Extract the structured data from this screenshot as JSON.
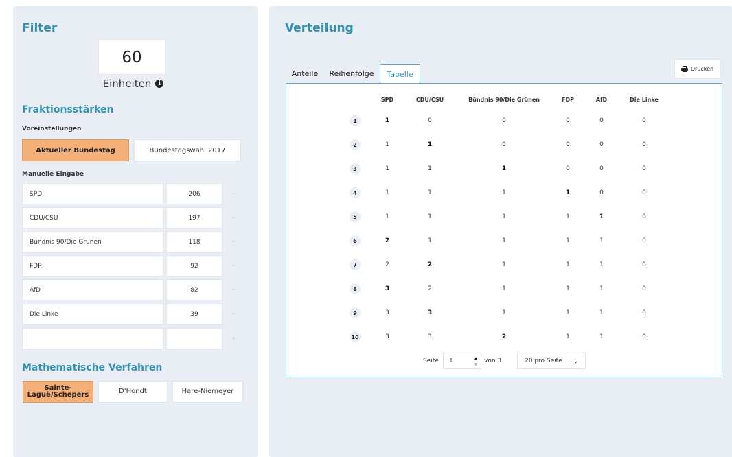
{
  "filter": {
    "title": "Filter",
    "units_value": "60",
    "units_label": "Einheiten",
    "info_icon": "info-icon",
    "fraktion_title": "Fraktionsstärken",
    "presets_label": "Voreinstellungen",
    "presets": [
      {
        "label": "Aktueller Bundestag",
        "active": true
      },
      {
        "label": "Bundestagswahl 2017",
        "active": false
      }
    ],
    "manual_label": "Manuelle Eingabe",
    "parties": [
      {
        "name": "SPD",
        "value": "206",
        "remove": "-"
      },
      {
        "name": "CDU/CSU",
        "value": "197",
        "remove": "-"
      },
      {
        "name": "Bündnis 90/Die Grünen",
        "value": "118",
        "remove": "-"
      },
      {
        "name": "FDP",
        "value": "92",
        "remove": "-"
      },
      {
        "name": "AfD",
        "value": "82",
        "remove": "-"
      },
      {
        "name": "Die Linke",
        "value": "39",
        "remove": "-"
      }
    ],
    "new_row": {
      "name": "",
      "value": "",
      "add": "+"
    },
    "method_title": "Mathematische Verfahren",
    "methods": [
      {
        "label": "Sainte-Laguë/Schepers",
        "active": true
      },
      {
        "label": "D'Hondt",
        "active": false
      },
      {
        "label": "Hare-Niemeyer",
        "active": false
      }
    ]
  },
  "distribution": {
    "title": "Verteilung",
    "tabs": [
      {
        "label": "Anteile",
        "active": false
      },
      {
        "label": "Reihenfolge",
        "active": false
      },
      {
        "label": "Tabelle",
        "active": true
      }
    ],
    "print_label": "Drucken",
    "print_icon": "printer-icon",
    "columns": [
      "SPD",
      "CDU/CSU",
      "Bündnis 90/Die Grünen",
      "FDP",
      "AfD",
      "Die Linke"
    ],
    "rows": [
      {
        "n": "1",
        "cells": [
          "1",
          "0",
          "0",
          "0",
          "0",
          "0"
        ],
        "bold": 0
      },
      {
        "n": "2",
        "cells": [
          "1",
          "1",
          "0",
          "0",
          "0",
          "0"
        ],
        "bold": 1
      },
      {
        "n": "3",
        "cells": [
          "1",
          "1",
          "1",
          "0",
          "0",
          "0"
        ],
        "bold": 2
      },
      {
        "n": "4",
        "cells": [
          "1",
          "1",
          "1",
          "1",
          "0",
          "0"
        ],
        "bold": 3
      },
      {
        "n": "5",
        "cells": [
          "1",
          "1",
          "1",
          "1",
          "1",
          "0"
        ],
        "bold": 4
      },
      {
        "n": "6",
        "cells": [
          "2",
          "1",
          "1",
          "1",
          "1",
          "0"
        ],
        "bold": 0
      },
      {
        "n": "7",
        "cells": [
          "2",
          "2",
          "1",
          "1",
          "1",
          "0"
        ],
        "bold": 1
      },
      {
        "n": "8",
        "cells": [
          "3",
          "2",
          "1",
          "1",
          "1",
          "0"
        ],
        "bold": 0
      },
      {
        "n": "9",
        "cells": [
          "3",
          "3",
          "1",
          "1",
          "1",
          "0"
        ],
        "bold": 1
      },
      {
        "n": "10",
        "cells": [
          "3",
          "3",
          "2",
          "1",
          "1",
          "0"
        ],
        "bold": 2
      }
    ],
    "pager": {
      "page_label": "Seite",
      "page_value": "1",
      "of_label": "von 3",
      "per_page": "20 pro Seite"
    }
  }
}
